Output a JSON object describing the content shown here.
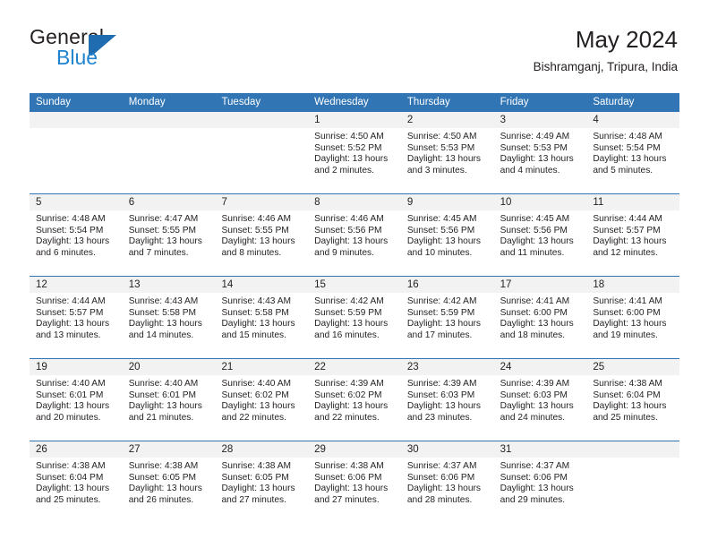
{
  "brand": {
    "name_part1": "General",
    "name_part2": "Blue",
    "flag_icon": "flag-triangle-icon",
    "color_dark": "#231f20",
    "color_blue": "#1f83d0",
    "color_flag": "#1f6cb0"
  },
  "header": {
    "title": "May 2024",
    "subtitle": "Bishramganj, Tripura, India"
  },
  "theme": {
    "header_bar": "#3175b4",
    "day_number_band": "#f2f2f2",
    "row_divider": "#3175b4",
    "text": "#231f20"
  },
  "weekdays": [
    "Sunday",
    "Monday",
    "Tuesday",
    "Wednesday",
    "Thursday",
    "Friday",
    "Saturday"
  ],
  "weeks": [
    [
      {
        "day": "",
        "sunrise": "",
        "sunset": "",
        "daylight_line1": "",
        "daylight_line2": ""
      },
      {
        "day": "",
        "sunrise": "",
        "sunset": "",
        "daylight_line1": "",
        "daylight_line2": ""
      },
      {
        "day": "",
        "sunrise": "",
        "sunset": "",
        "daylight_line1": "",
        "daylight_line2": ""
      },
      {
        "day": "1",
        "sunrise": "Sunrise: 4:50 AM",
        "sunset": "Sunset: 5:52 PM",
        "daylight_line1": "Daylight: 13 hours",
        "daylight_line2": "and 2 minutes."
      },
      {
        "day": "2",
        "sunrise": "Sunrise: 4:50 AM",
        "sunset": "Sunset: 5:53 PM",
        "daylight_line1": "Daylight: 13 hours",
        "daylight_line2": "and 3 minutes."
      },
      {
        "day": "3",
        "sunrise": "Sunrise: 4:49 AM",
        "sunset": "Sunset: 5:53 PM",
        "daylight_line1": "Daylight: 13 hours",
        "daylight_line2": "and 4 minutes."
      },
      {
        "day": "4",
        "sunrise": "Sunrise: 4:48 AM",
        "sunset": "Sunset: 5:54 PM",
        "daylight_line1": "Daylight: 13 hours",
        "daylight_line2": "and 5 minutes."
      }
    ],
    [
      {
        "day": "5",
        "sunrise": "Sunrise: 4:48 AM",
        "sunset": "Sunset: 5:54 PM",
        "daylight_line1": "Daylight: 13 hours",
        "daylight_line2": "and 6 minutes."
      },
      {
        "day": "6",
        "sunrise": "Sunrise: 4:47 AM",
        "sunset": "Sunset: 5:55 PM",
        "daylight_line1": "Daylight: 13 hours",
        "daylight_line2": "and 7 minutes."
      },
      {
        "day": "7",
        "sunrise": "Sunrise: 4:46 AM",
        "sunset": "Sunset: 5:55 PM",
        "daylight_line1": "Daylight: 13 hours",
        "daylight_line2": "and 8 minutes."
      },
      {
        "day": "8",
        "sunrise": "Sunrise: 4:46 AM",
        "sunset": "Sunset: 5:56 PM",
        "daylight_line1": "Daylight: 13 hours",
        "daylight_line2": "and 9 minutes."
      },
      {
        "day": "9",
        "sunrise": "Sunrise: 4:45 AM",
        "sunset": "Sunset: 5:56 PM",
        "daylight_line1": "Daylight: 13 hours",
        "daylight_line2": "and 10 minutes."
      },
      {
        "day": "10",
        "sunrise": "Sunrise: 4:45 AM",
        "sunset": "Sunset: 5:56 PM",
        "daylight_line1": "Daylight: 13 hours",
        "daylight_line2": "and 11 minutes."
      },
      {
        "day": "11",
        "sunrise": "Sunrise: 4:44 AM",
        "sunset": "Sunset: 5:57 PM",
        "daylight_line1": "Daylight: 13 hours",
        "daylight_line2": "and 12 minutes."
      }
    ],
    [
      {
        "day": "12",
        "sunrise": "Sunrise: 4:44 AM",
        "sunset": "Sunset: 5:57 PM",
        "daylight_line1": "Daylight: 13 hours",
        "daylight_line2": "and 13 minutes."
      },
      {
        "day": "13",
        "sunrise": "Sunrise: 4:43 AM",
        "sunset": "Sunset: 5:58 PM",
        "daylight_line1": "Daylight: 13 hours",
        "daylight_line2": "and 14 minutes."
      },
      {
        "day": "14",
        "sunrise": "Sunrise: 4:43 AM",
        "sunset": "Sunset: 5:58 PM",
        "daylight_line1": "Daylight: 13 hours",
        "daylight_line2": "and 15 minutes."
      },
      {
        "day": "15",
        "sunrise": "Sunrise: 4:42 AM",
        "sunset": "Sunset: 5:59 PM",
        "daylight_line1": "Daylight: 13 hours",
        "daylight_line2": "and 16 minutes."
      },
      {
        "day": "16",
        "sunrise": "Sunrise: 4:42 AM",
        "sunset": "Sunset: 5:59 PM",
        "daylight_line1": "Daylight: 13 hours",
        "daylight_line2": "and 17 minutes."
      },
      {
        "day": "17",
        "sunrise": "Sunrise: 4:41 AM",
        "sunset": "Sunset: 6:00 PM",
        "daylight_line1": "Daylight: 13 hours",
        "daylight_line2": "and 18 minutes."
      },
      {
        "day": "18",
        "sunrise": "Sunrise: 4:41 AM",
        "sunset": "Sunset: 6:00 PM",
        "daylight_line1": "Daylight: 13 hours",
        "daylight_line2": "and 19 minutes."
      }
    ],
    [
      {
        "day": "19",
        "sunrise": "Sunrise: 4:40 AM",
        "sunset": "Sunset: 6:01 PM",
        "daylight_line1": "Daylight: 13 hours",
        "daylight_line2": "and 20 minutes."
      },
      {
        "day": "20",
        "sunrise": "Sunrise: 4:40 AM",
        "sunset": "Sunset: 6:01 PM",
        "daylight_line1": "Daylight: 13 hours",
        "daylight_line2": "and 21 minutes."
      },
      {
        "day": "21",
        "sunrise": "Sunrise: 4:40 AM",
        "sunset": "Sunset: 6:02 PM",
        "daylight_line1": "Daylight: 13 hours",
        "daylight_line2": "and 22 minutes."
      },
      {
        "day": "22",
        "sunrise": "Sunrise: 4:39 AM",
        "sunset": "Sunset: 6:02 PM",
        "daylight_line1": "Daylight: 13 hours",
        "daylight_line2": "and 22 minutes."
      },
      {
        "day": "23",
        "sunrise": "Sunrise: 4:39 AM",
        "sunset": "Sunset: 6:03 PM",
        "daylight_line1": "Daylight: 13 hours",
        "daylight_line2": "and 23 minutes."
      },
      {
        "day": "24",
        "sunrise": "Sunrise: 4:39 AM",
        "sunset": "Sunset: 6:03 PM",
        "daylight_line1": "Daylight: 13 hours",
        "daylight_line2": "and 24 minutes."
      },
      {
        "day": "25",
        "sunrise": "Sunrise: 4:38 AM",
        "sunset": "Sunset: 6:04 PM",
        "daylight_line1": "Daylight: 13 hours",
        "daylight_line2": "and 25 minutes."
      }
    ],
    [
      {
        "day": "26",
        "sunrise": "Sunrise: 4:38 AM",
        "sunset": "Sunset: 6:04 PM",
        "daylight_line1": "Daylight: 13 hours",
        "daylight_line2": "and 25 minutes."
      },
      {
        "day": "27",
        "sunrise": "Sunrise: 4:38 AM",
        "sunset": "Sunset: 6:05 PM",
        "daylight_line1": "Daylight: 13 hours",
        "daylight_line2": "and 26 minutes."
      },
      {
        "day": "28",
        "sunrise": "Sunrise: 4:38 AM",
        "sunset": "Sunset: 6:05 PM",
        "daylight_line1": "Daylight: 13 hours",
        "daylight_line2": "and 27 minutes."
      },
      {
        "day": "29",
        "sunrise": "Sunrise: 4:38 AM",
        "sunset": "Sunset: 6:06 PM",
        "daylight_line1": "Daylight: 13 hours",
        "daylight_line2": "and 27 minutes."
      },
      {
        "day": "30",
        "sunrise": "Sunrise: 4:37 AM",
        "sunset": "Sunset: 6:06 PM",
        "daylight_line1": "Daylight: 13 hours",
        "daylight_line2": "and 28 minutes."
      },
      {
        "day": "31",
        "sunrise": "Sunrise: 4:37 AM",
        "sunset": "Sunset: 6:06 PM",
        "daylight_line1": "Daylight: 13 hours",
        "daylight_line2": "and 29 minutes."
      },
      {
        "day": "",
        "sunrise": "",
        "sunset": "",
        "daylight_line1": "",
        "daylight_line2": ""
      }
    ]
  ]
}
